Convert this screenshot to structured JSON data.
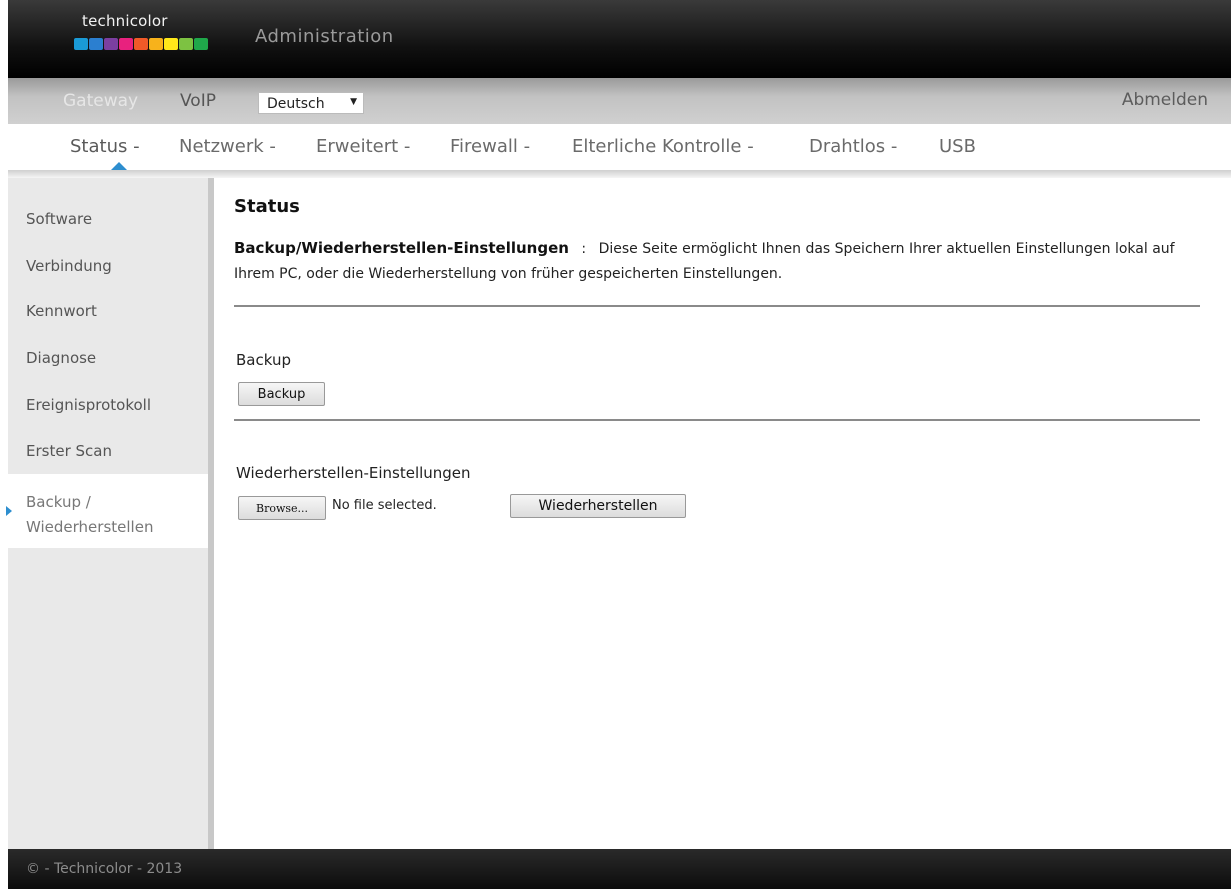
{
  "header": {
    "logo_text": "technicolor",
    "logo_colors": [
      "#1a9ad6",
      "#2b7fd0",
      "#7b3fa0",
      "#e8217e",
      "#f05a28",
      "#f7b21b",
      "#ffe81a",
      "#7dc242",
      "#1fa84a"
    ],
    "title": "Administration"
  },
  "topbar": {
    "gateway": "Gateway",
    "voip": "VoIP",
    "language": "Deutsch",
    "logout": "Abmelden"
  },
  "nav": {
    "items": [
      "Status -",
      "Netzwerk -",
      "Erweitert -",
      "Firewall -",
      "Elterliche Kontrolle -",
      "Drahtlos -",
      "USB"
    ],
    "active": "Status -",
    "accent_color": "#2d8ecf"
  },
  "sidebar": {
    "items": [
      "Software",
      "Verbindung",
      "Kennwort",
      "Diagnose",
      "Ereignisprotokoll",
      "Erster Scan"
    ],
    "active_line1": "Backup /",
    "active_line2": "Wiederherstellen"
  },
  "main": {
    "title": "Status",
    "desc_heading": "Backup/Wiederherstellen-Einstellungen",
    "desc_sep": ":",
    "desc_text": "Diese Seite ermöglicht Ihnen das Speichern Ihrer aktuellen Einstellungen lokal auf Ihrem PC, oder die Wiederherstellung von früher gespeicherten Einstellungen.",
    "backup_label": "Backup",
    "backup_button": "Backup",
    "restore_label": "Wiederherstellen-Einstellungen",
    "browse_button": "Browse...",
    "no_file": "No file selected.",
    "restore_button": "Wiederherstellen"
  },
  "footer": {
    "text": "© - Technicolor - 2013"
  }
}
